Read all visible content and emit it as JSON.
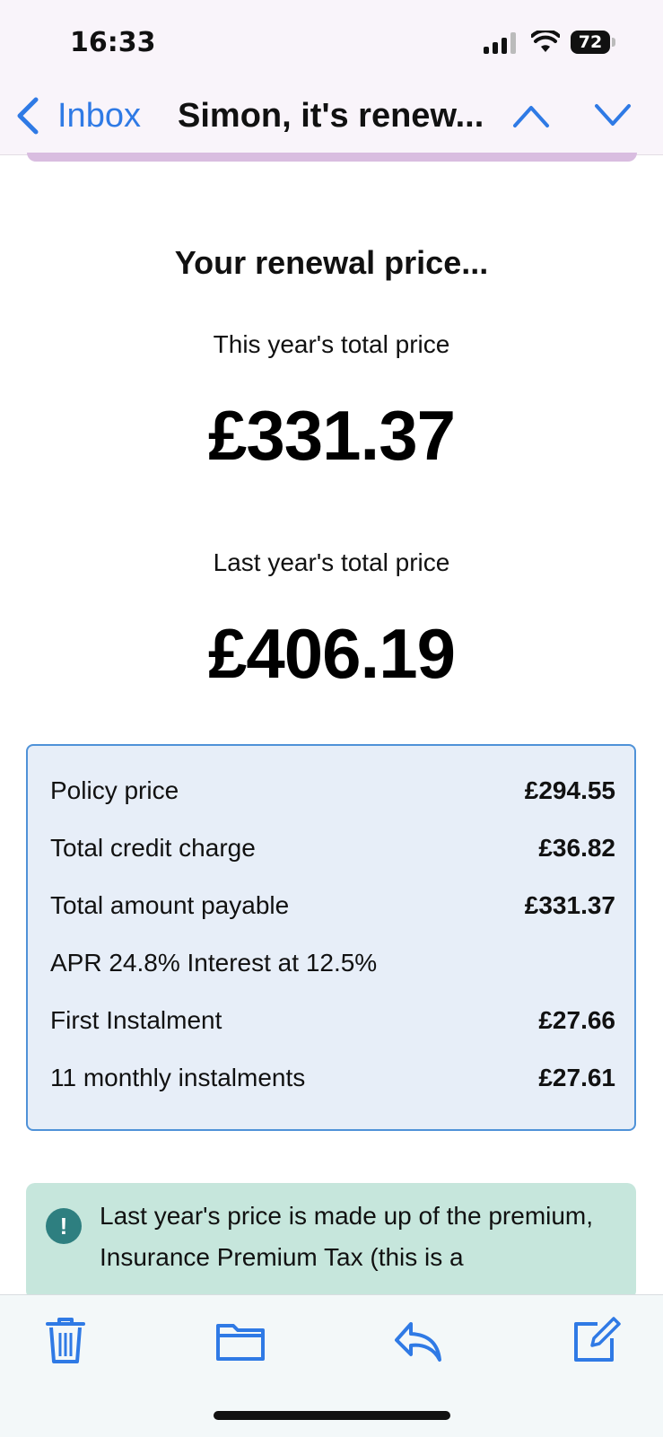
{
  "status_bar": {
    "time": "16:33",
    "battery": "72"
  },
  "nav": {
    "back_label": "Inbox",
    "subject": "Simon, it's renew..."
  },
  "renewal": {
    "heading": "Your renewal price...",
    "this_year_label": "This year's total price",
    "this_year_price": "£331.37",
    "last_year_label": "Last year's total price",
    "last_year_price": "£406.19"
  },
  "breakdown": {
    "rows": [
      {
        "label": "Policy price",
        "value": "£294.55"
      },
      {
        "label": "Total credit charge",
        "value": "£36.82"
      },
      {
        "label": "Total amount payable",
        "value": "£331.37"
      },
      {
        "label": "APR 24.8% Interest at 12.5%",
        "value": ""
      },
      {
        "label": "First Instalment",
        "value": "£27.66"
      },
      {
        "label": "11 monthly instalments",
        "value": "£27.61"
      }
    ]
  },
  "info": {
    "icon": "!",
    "text": "Last year's price is made up of the premium, Insurance Premium Tax (this is a"
  },
  "toolbar": {
    "icons": [
      "trash-icon",
      "folder-icon",
      "reply-icon",
      "compose-icon"
    ]
  },
  "colors": {
    "accent": "#2f7ae5",
    "box_bg": "#e7eef8",
    "box_border": "#4f92d8",
    "info_bg": "#c6e6dc",
    "info_icon": "#2e7f80"
  }
}
